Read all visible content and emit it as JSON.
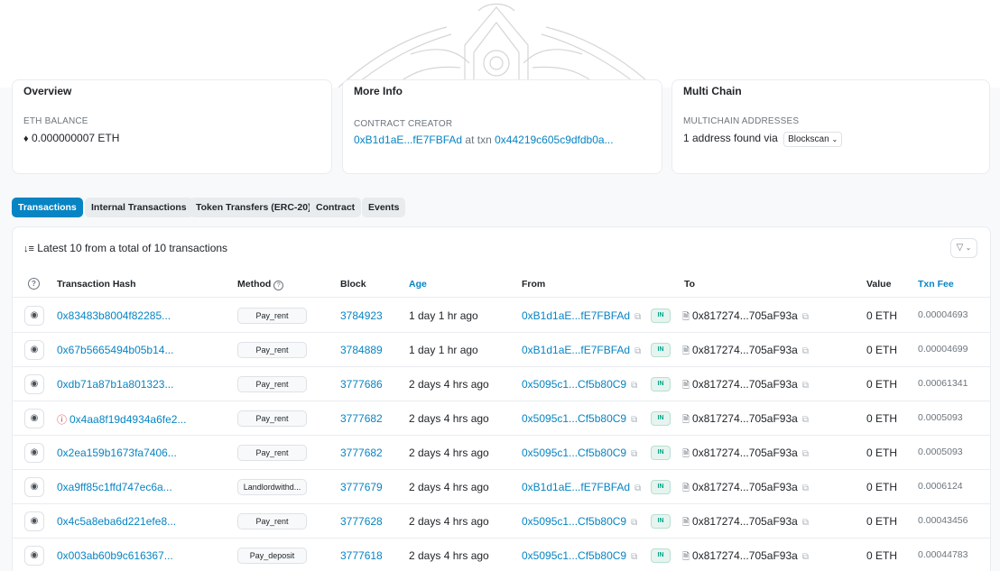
{
  "overview": {
    "title": "Overview",
    "eth_balance_label": "ETH BALANCE",
    "eth_balance_value": "0.000000007 ETH",
    "eth_icon": "eth-diamond-icon"
  },
  "more_info": {
    "title": "More Info",
    "creator_label": "CONTRACT CREATOR",
    "creator_address": "0xB1d1aE...fE7FBFAd",
    "creator_at_txn": "at txn",
    "creator_txn": "0x44219c605c9dfdb0a..."
  },
  "multi_chain": {
    "title": "Multi Chain",
    "label": "MULTICHAIN ADDRESSES",
    "found_text": "1 address found via",
    "dropdown_label": "Blockscan"
  },
  "tabs": [
    {
      "label": "Transactions",
      "active": true
    },
    {
      "label": "Internal Transactions",
      "active": false
    },
    {
      "label": "Token Transfers (ERC-20)",
      "active": false
    },
    {
      "label": "Contract",
      "active": false
    },
    {
      "label": "Events",
      "active": false
    }
  ],
  "table": {
    "summary": "Latest 10 from a total of 10 transactions",
    "headers": {
      "hash": "Transaction Hash",
      "method": "Method",
      "block": "Block",
      "age": "Age",
      "from": "From",
      "to": "To",
      "value": "Value",
      "fee": "Txn Fee"
    },
    "rows": [
      {
        "hash": "0x83483b8004f82285...",
        "method": "Pay_rent",
        "block": "3784923",
        "age": "1 day 1 hr ago",
        "from": "0xB1d1aE...fE7FBFAd",
        "direction": "IN",
        "to": "0x817274...705aF93a",
        "value": "0 ETH",
        "fee": "0.00004693",
        "error": false
      },
      {
        "hash": "0x67b5665494b05b14...",
        "method": "Pay_rent",
        "block": "3784889",
        "age": "1 day 1 hr ago",
        "from": "0xB1d1aE...fE7FBFAd",
        "direction": "IN",
        "to": "0x817274...705aF93a",
        "value": "0 ETH",
        "fee": "0.00004699",
        "error": false
      },
      {
        "hash": "0xdb71a87b1a801323...",
        "method": "Pay_rent",
        "block": "3777686",
        "age": "2 days 4 hrs ago",
        "from": "0x5095c1...Cf5b80C9",
        "direction": "IN",
        "to": "0x817274...705aF93a",
        "value": "0 ETH",
        "fee": "0.00061341",
        "error": false
      },
      {
        "hash": "0x4aa8f19d4934a6fe2...",
        "method": "Pay_rent",
        "block": "3777682",
        "age": "2 days 4 hrs ago",
        "from": "0x5095c1...Cf5b80C9",
        "direction": "IN",
        "to": "0x817274...705aF93a",
        "value": "0 ETH",
        "fee": "0.0005093",
        "error": true
      },
      {
        "hash": "0x2ea159b1673fa7406...",
        "method": "Pay_rent",
        "block": "3777682",
        "age": "2 days 4 hrs ago",
        "from": "0x5095c1...Cf5b80C9",
        "direction": "IN",
        "to": "0x817274...705aF93a",
        "value": "0 ETH",
        "fee": "0.0005093",
        "error": false
      },
      {
        "hash": "0xa9ff85c1ffd747ec6a...",
        "method": "Landlordwithd...",
        "block": "3777679",
        "age": "2 days 4 hrs ago",
        "from": "0xB1d1aE...fE7FBFAd",
        "direction": "IN",
        "to": "0x817274...705aF93a",
        "value": "0 ETH",
        "fee": "0.0006124",
        "error": false
      },
      {
        "hash": "0x4c5a8eba6d221efe8...",
        "method": "Pay_rent",
        "block": "3777628",
        "age": "2 days 4 hrs ago",
        "from": "0x5095c1...Cf5b80C9",
        "direction": "IN",
        "to": "0x817274...705aF93a",
        "value": "0 ETH",
        "fee": "0.00043456",
        "error": false
      },
      {
        "hash": "0x003ab60b9c616367...",
        "method": "Pay_deposit",
        "block": "3777618",
        "age": "2 days 4 hrs ago",
        "from": "0x5095c1...Cf5b80C9",
        "direction": "IN",
        "to": "0x817274...705aF93a",
        "value": "0 ETH",
        "fee": "0.00044783",
        "error": false
      }
    ]
  },
  "colors": {
    "link": "#0784c3",
    "active_tab": "#0784c3",
    "in_badge": "#00a186",
    "error": "#dc3545"
  }
}
